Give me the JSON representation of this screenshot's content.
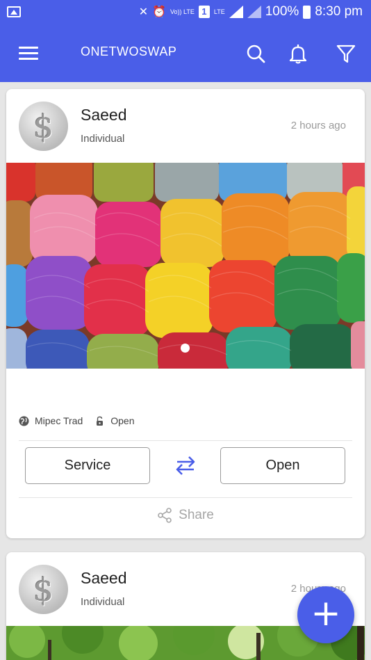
{
  "status_bar": {
    "battery": "100%",
    "time": "8:30 pm",
    "sim_badge": "1",
    "volte_label": "Vo)) LTE",
    "lte_label": "LTE"
  },
  "app_bar": {
    "title": "ONETWOSWAP",
    "icons": [
      "menu-icon",
      "search-icon",
      "bell-icon",
      "filter-icon"
    ]
  },
  "posts": [
    {
      "user_name": "Saeed",
      "user_type": "Individual",
      "time_ago": "2 hours ago",
      "image_subject": "colorful yarn balls",
      "location": "Mipec Trad",
      "status": "Open",
      "left_button": "Service",
      "right_button": "Open",
      "share_label": "Share"
    },
    {
      "user_name": "Saeed",
      "user_type": "Individual",
      "time_ago": "2 hours ago",
      "image_subject": "forest trees"
    }
  ],
  "fab": {
    "label": "+"
  },
  "colors": {
    "accent": "#4a5ee8",
    "card_bg": "#ffffff",
    "page_bg": "#e6e6e6"
  }
}
